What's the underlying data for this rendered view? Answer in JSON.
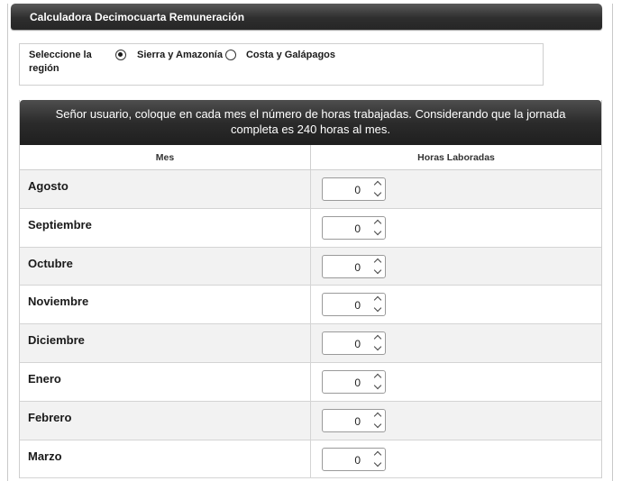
{
  "app": {
    "title": "Calculadora Decimocuarta Remuneración"
  },
  "region": {
    "label": "Seleccione la región",
    "options": [
      {
        "label": "Sierra y Amazonía",
        "selected": true
      },
      {
        "label": "Costa y Galápagos",
        "selected": false
      }
    ]
  },
  "table": {
    "instructions": "Señor usuario, coloque en cada mes el número de horas trabajadas. Considerando que la jornada completa es 240 horas al mes.",
    "headers": {
      "mes": "Mes",
      "horas": "Horas Laboradas"
    },
    "rows": [
      {
        "mes": "Agosto",
        "horas": "0"
      },
      {
        "mes": "Septiembre",
        "horas": "0"
      },
      {
        "mes": "Octubre",
        "horas": "0"
      },
      {
        "mes": "Noviembre",
        "horas": "0"
      },
      {
        "mes": "Diciembre",
        "horas": "0"
      },
      {
        "mes": "Enero",
        "horas": "0"
      },
      {
        "mes": "Febrero",
        "horas": "0"
      },
      {
        "mes": "Marzo",
        "horas": "0"
      }
    ]
  },
  "colors": {
    "header_dark": "#2e2e2e",
    "row_alt": "#f2f2f2",
    "border": "#cfcfcf"
  },
  "icons": {
    "spinner_up": "chevron-up-icon",
    "spinner_down": "chevron-down-icon"
  }
}
